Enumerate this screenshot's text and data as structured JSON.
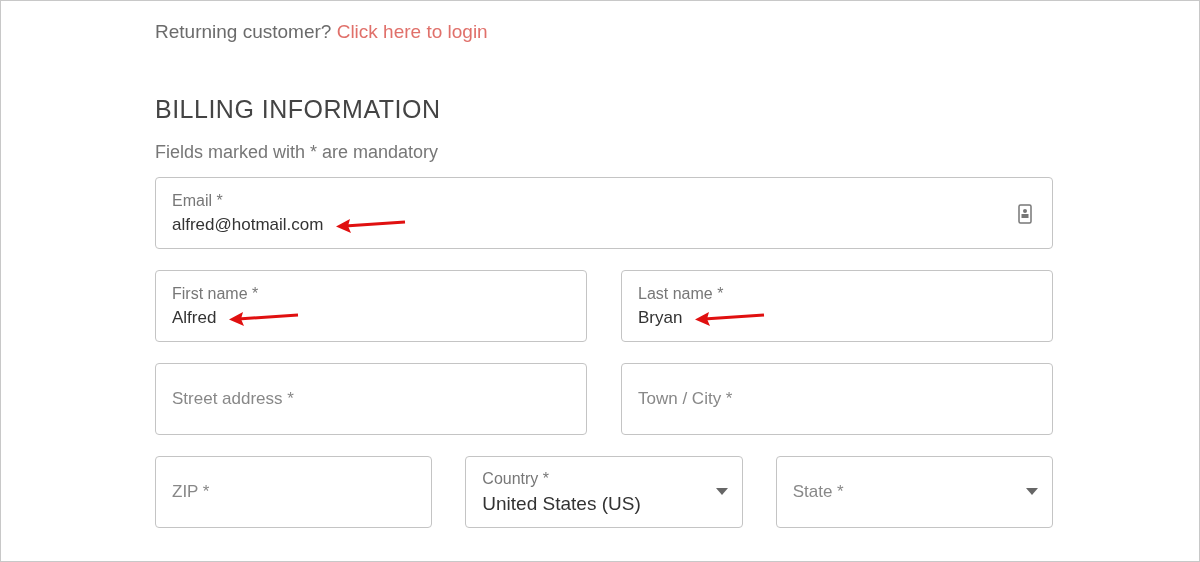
{
  "returning": {
    "prompt": "Returning customer?",
    "link": "Click here to login"
  },
  "heading": "BILLING INFORMATION",
  "note": "Fields marked with * are mandatory",
  "rows": [
    [
      {
        "kind": "text",
        "label": "Email *",
        "value": "alfred@hotmail.com",
        "annotated": true,
        "contact_icon": true
      }
    ],
    [
      {
        "kind": "text",
        "label": "First name *",
        "value": "Alfred",
        "annotated": true
      },
      {
        "kind": "text",
        "label": "Last name *",
        "value": "Bryan",
        "annotated": true
      }
    ],
    [
      {
        "kind": "text",
        "label": "Street address *"
      },
      {
        "kind": "text",
        "label": "Town / City *"
      }
    ],
    [
      {
        "kind": "text",
        "label": "ZIP *"
      },
      {
        "kind": "select",
        "label": "Country *",
        "value": "United States (US)"
      },
      {
        "kind": "select",
        "label": "State *"
      }
    ]
  ]
}
